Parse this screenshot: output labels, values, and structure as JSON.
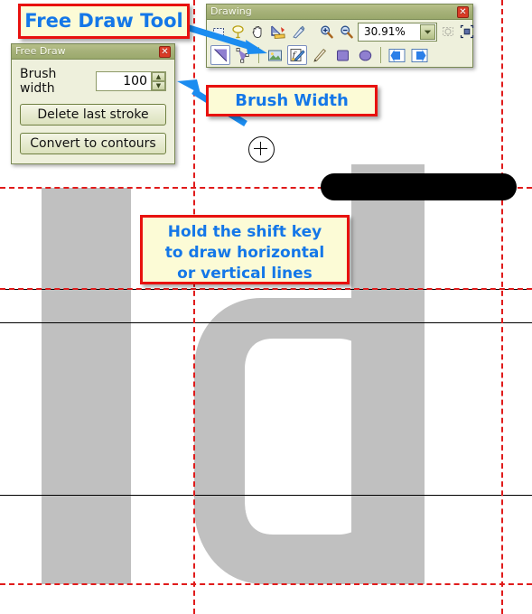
{
  "app": {
    "canvas_background": "#ffffff",
    "glyph_color": "#c0c0c0",
    "ink_color": "#000000",
    "guide_color": "#e01b1b"
  },
  "free_draw_panel": {
    "title": "Free Draw",
    "close_icon": "close-icon",
    "close_label": "✕",
    "brush_width_label": "Brush width",
    "brush_width_value": "100",
    "spinner_up": "▲",
    "spinner_down": "▼",
    "delete_last_stroke_label": "Delete last stroke",
    "convert_to_contours_label": "Convert to contours"
  },
  "drawing_toolbar": {
    "title": "Drawing",
    "close_label": "✕",
    "zoom_value": "30.91%",
    "zoom_dropdown_icon": "chevron-down-icon",
    "row1": [
      {
        "name": "marquee-select-icon",
        "label": "Select rectangle"
      },
      {
        "name": "lasso-icon",
        "label": "Lasso / magic wand"
      },
      {
        "name": "hand-pan-icon",
        "label": "Pan"
      },
      {
        "name": "measure-ruler-icon",
        "label": "Measure"
      },
      {
        "name": "knife-cut-icon",
        "label": "Knife"
      },
      {
        "name": "zoom-in-icon",
        "label": "Zoom in"
      },
      {
        "name": "zoom-out-icon",
        "label": "Zoom out"
      },
      {
        "name": "zoom-to-selection-icon",
        "label": "Zoom to selection"
      },
      {
        "name": "fit-to-window-icon",
        "label": "Fit in window"
      }
    ],
    "row2": [
      {
        "name": "corner-point-icon",
        "label": "Add corner point"
      },
      {
        "name": "curve-point-icon",
        "label": "Add curve point"
      },
      {
        "name": "image-import-icon",
        "label": "Import image"
      },
      {
        "name": "free-draw-icon",
        "label": "Free draw",
        "active": true
      },
      {
        "name": "pencil-icon",
        "label": "Pencil"
      },
      {
        "name": "rectangle-icon",
        "label": "Rectangle"
      },
      {
        "name": "ellipse-icon",
        "label": "Ellipse"
      },
      {
        "name": "arrow-left-icon",
        "label": "Previous glyph"
      },
      {
        "name": "arrow-right-icon",
        "label": "Next glyph"
      }
    ]
  },
  "callouts": [
    {
      "id": "free-draw-tool",
      "text": "Free Draw Tool"
    },
    {
      "id": "brush-width",
      "text": "Brush Width"
    },
    {
      "id": "shift-key",
      "lines": [
        "Hold the shift key",
        "to draw horizontal",
        "or vertical lines"
      ]
    }
  ],
  "guides": {
    "horizontal_dashed": [
      207,
      320,
      647
    ],
    "horizontal_solid": [
      357,
      548
    ],
    "vertical_dashed": [
      214,
      555
    ]
  }
}
